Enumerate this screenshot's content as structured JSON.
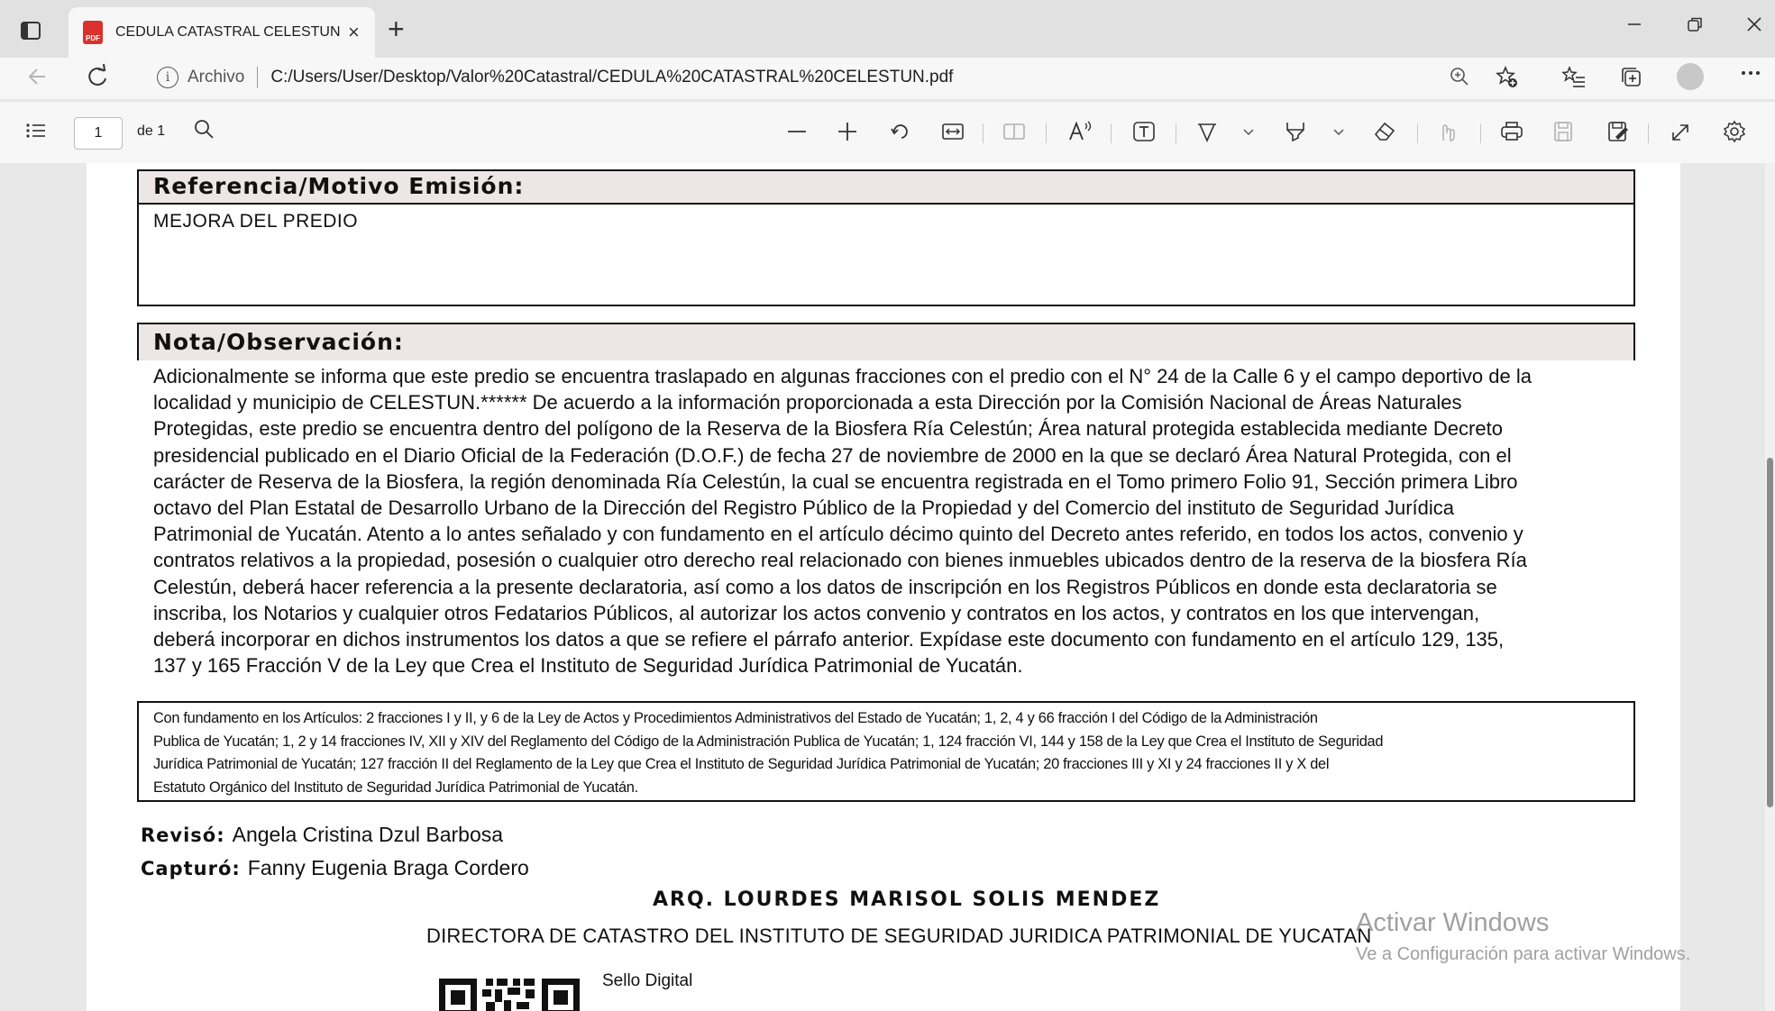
{
  "browser": {
    "tab_title": "CEDULA CATASTRAL CELESTUN.pdf",
    "tab_close": "×",
    "new_tab": "+",
    "url_prefix": "Archivo",
    "url": "C:/Users/User/Desktop/Valor%20Catastral/CEDULA%20CATASTRAL%20CELESTUN.pdf"
  },
  "pdf_toolbar": {
    "page_number": "1",
    "page_of": "de 1"
  },
  "document": {
    "referencia_header": "Referencia/Motivo Emisión:",
    "referencia_body": "MEJORA DEL PREDIO",
    "nota_header": "Nota/Observación:",
    "nota_lines": [
      "Adicionalmente se informa que este predio se encuentra traslapado en algunas fracciones con el predio con el N° 24 de la Calle 6 y el campo deportivo de la",
      "localidad y municipio de CELESTUN.****** De acuerdo a la información proporcionada a esta Dirección por la Comisión Nacional de Áreas Naturales",
      "Protegidas, este predio se encuentra dentro del polígono de la Reserva de la Biosfera Ría Celestún; Área natural protegida establecida mediante Decreto",
      "presidencial publicado en el Diario Oficial de la Federación (D.O.F.) de fecha 27 de noviembre de 2000 en la que se declaró Área Natural Protegida, con el",
      "carácter de Reserva de la Biosfera, la región denominada Ría Celestún, la cual se encuentra registrada en el Tomo primero Folio 91, Sección primera Libro",
      "octavo del Plan Estatal de Desarrollo Urbano de la Dirección del Registro Público de la Propiedad y del Comercio del instituto de Seguridad Jurídica",
      "Patrimonial de Yucatán. Atento a lo antes señalado y con fundamento en el artículo décimo quinto del Decreto antes referido, en todos los actos, convenio y",
      "contratos relativos a la propiedad, posesión o cualquier otro derecho real relacionado con bienes inmuebles ubicados dentro de la reserva de la biosfera Ría",
      "Celestún, deberá hacer referencia a la presente declaratoria, así como a los datos de inscripción en los Registros Públicos en donde esta declaratoria se",
      "inscriba, los Notarios y cualquier otros Fedatarios Públicos, al autorizar los actos convenio y contratos en los actos, y contratos en los que intervengan,",
      "deberá incorporar en dichos instrumentos los datos a que se refiere el párrafo anterior. Expídase este documento con fundamento en el artículo 129, 135,",
      "137 y 165 Fracción V de la Ley que Crea el Instituto de Seguridad Jurídica Patrimonial de Yucatán."
    ],
    "legal_lines": [
      "Con fundamento en los Artículos: 2 fracciones I y II, y 6 de la Ley de Actos y Procedimientos Administrativos del Estado de Yucatán; 1, 2, 4 y 66 fracción I del Código de la Administración",
      "Publica de Yucatán; 1, 2 y 14 fracciones IV, XII y XIV del Reglamento del Código de la Administración Publica de Yucatán; 1, 124 fracción VI, 144 y 158 de la Ley que Crea el Instituto de Seguridad",
      "Jurídica Patrimonial de Yucatán; 127 fracción II del Reglamento de la Ley que Crea el Instituto de Seguridad Jurídica Patrimonial de Yucatán; 20 fracciones III y XI y 24 fracciones II y X del",
      "Estatuto Orgánico del Instituto de Seguridad Jurídica Patrimonial de Yucatán."
    ],
    "reviso_label": "Revisó:",
    "reviso_name": "Angela Cristina Dzul Barbosa",
    "capturo_label": "Capturó:",
    "capturo_name": "Fanny Eugenia Braga Cordero",
    "director_name": "ARQ. LOURDES MARISOL SOLIS MENDEZ",
    "director_title": "DIRECTORA DE CATASTRO DEL INSTITUTO DE SEGURIDAD JURIDICA PATRIMONIAL DE YUCATAN",
    "sello_label": "Sello Digital"
  },
  "watermark": {
    "line1": "Activar Windows",
    "line2": "Ve a Configuración para activar Windows."
  }
}
